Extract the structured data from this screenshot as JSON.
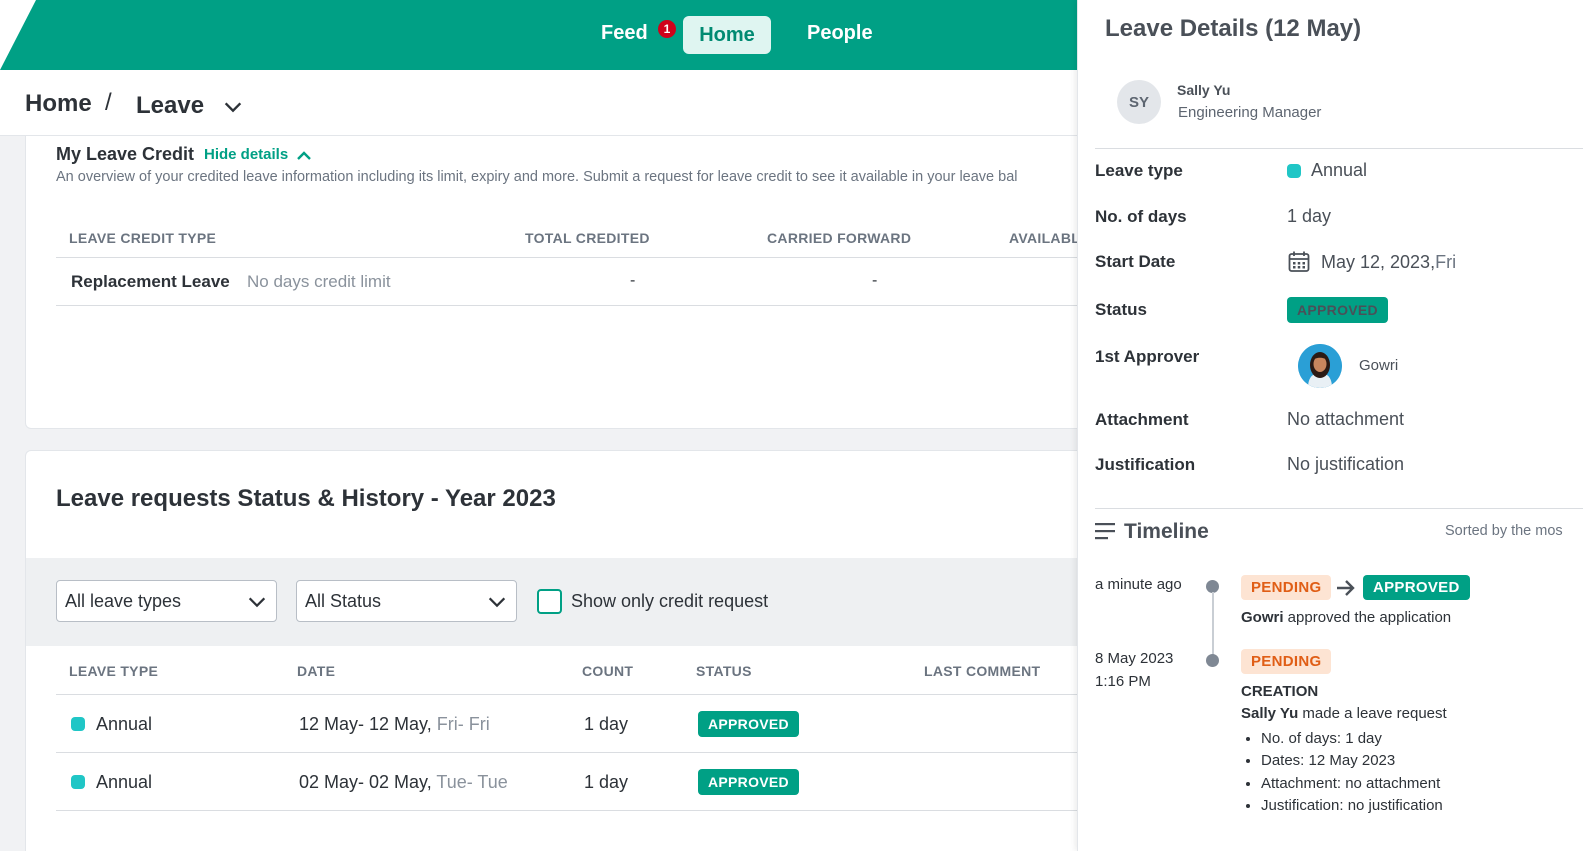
{
  "nav": {
    "feed": "Feed",
    "feed_badge": "1",
    "home": "Home",
    "people": "People"
  },
  "breadcrumb": {
    "home": "Home",
    "separator": "/",
    "current": "Leave"
  },
  "credit": {
    "title": "My Leave Credit",
    "hide_details": "Hide details",
    "description": "An overview of your credited leave information including its limit, expiry and more. Submit a request for leave credit to see it available in your leave bal",
    "columns": [
      "LEAVE CREDIT TYPE",
      "TOTAL CREDITED",
      "CARRIED FORWARD",
      "AVAILABL"
    ],
    "rows": [
      {
        "type": "Replacement Leave",
        "note": "No days credit limit",
        "total": "-",
        "carried": "-"
      }
    ]
  },
  "requests": {
    "title": "Leave requests Status & History - Year 2023",
    "filter_type": "All leave types",
    "filter_status": "All Status",
    "credit_only_label": "Show only credit request",
    "columns": [
      "LEAVE TYPE",
      "DATE",
      "COUNT",
      "STATUS",
      "LAST COMMENT"
    ],
    "rows": [
      {
        "type": "Annual",
        "date": "12 May- 12 May,",
        "days": " Fri- Fri",
        "count": "1 day",
        "status": "APPROVED"
      },
      {
        "type": "Annual",
        "date": "02 May- 02 May,",
        "days": " Tue- Tue",
        "count": "1 day",
        "status": "APPROVED"
      }
    ]
  },
  "panel": {
    "title": "Leave Details (12 May)",
    "initials": "SY",
    "name": "Sally Yu",
    "role": "Engineering Manager",
    "labels": {
      "leave_type": "Leave type",
      "days": "No. of days",
      "start": "Start Date",
      "status": "Status",
      "approver": "1st Approver",
      "attachment": "Attachment",
      "justification": "Justification"
    },
    "values": {
      "leave_type": "Annual",
      "days": "1 day",
      "start_date": "May 12, 2023,",
      "start_day": " Fri",
      "status": "APPROVED",
      "approver": "Gowri",
      "attachment": "No attachment",
      "justification": "No justification"
    },
    "timeline": {
      "title": "Timeline",
      "sort": "Sorted by the mos",
      "entries": [
        {
          "time": "a minute ago",
          "from": "PENDING",
          "to": "APPROVED",
          "actor": "Gowri",
          "action": " approved the application"
        },
        {
          "time": "8 May 2023",
          "time2": "1:16 PM",
          "status": "PENDING",
          "kind": "CREATION",
          "actor": "Sally Yu",
          "action": " made a leave request",
          "details": [
            "No. of days: 1 day",
            "Dates: 12 May 2023",
            "Attachment: no attachment",
            "Justification: no justification"
          ]
        }
      ]
    }
  },
  "colors": {
    "brand": "#00a085",
    "annual": "#20c6c6",
    "pending_bg": "#fde4d3",
    "pending_text": "#e05e16"
  }
}
